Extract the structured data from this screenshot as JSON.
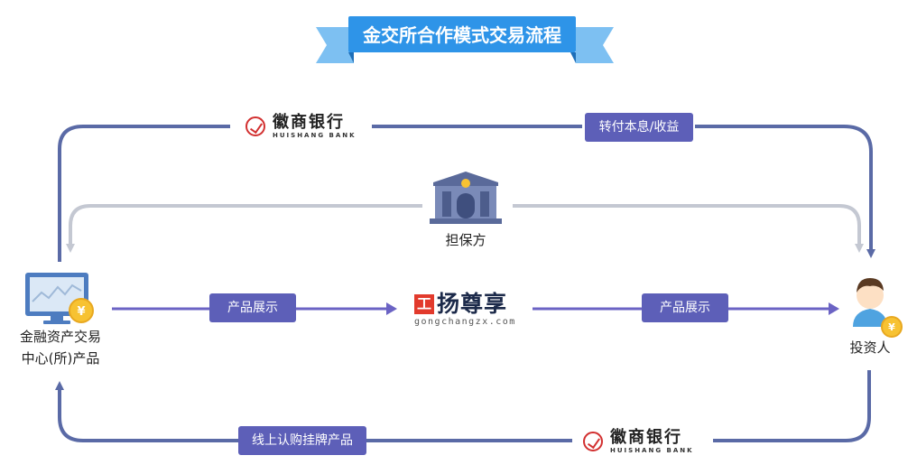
{
  "title": "金交所合作模式交易流程",
  "bank": {
    "name": "徽商银行",
    "sub": "HUISHANG BANK"
  },
  "guarantor": "担保方",
  "platform": {
    "name": "扬尊享",
    "url": "gongchangzx.com",
    "mark": "工"
  },
  "source": {
    "line1": "金融资产交易",
    "line2": "中心(所)产品"
  },
  "investor": "投资人",
  "tags": {
    "top_right": "转付本息/收益",
    "mid_left": "产品展示",
    "mid_right": "产品展示",
    "bottom_left": "线上认购挂牌产品"
  },
  "colors": {
    "flow": "#5a6aa6",
    "guarantee": "#c4c8d2",
    "arrow": "#6b63c4",
    "tag": "#5d5fb8",
    "banner": "#2e94e8"
  }
}
